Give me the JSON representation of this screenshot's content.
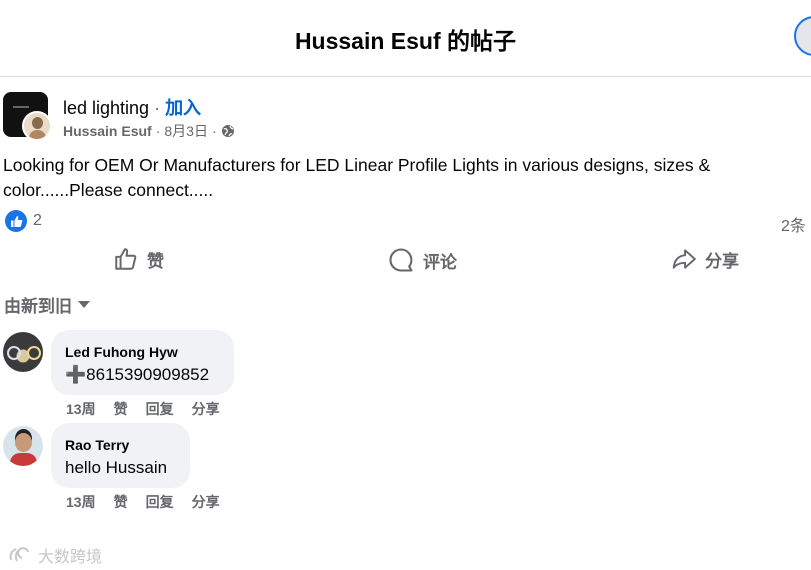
{
  "header": {
    "title": "Hussain Esuf 的帖子"
  },
  "post": {
    "group_name": "led lighting",
    "separator": " · ",
    "join_label": "加入",
    "author": "Hussain Esuf",
    "date": "8月3日",
    "meta_separator": "·",
    "privacy_icon": "globe-icon",
    "text": "Looking for OEM Or Manufacturers for LED Linear Profile Lights in various designs, sizes & color......Please connect.....",
    "reaction_icon": "like-icon",
    "reaction_count": "2",
    "comment_count": "2条"
  },
  "actions": {
    "like": "赞",
    "comment": "评论",
    "share": "分享"
  },
  "sort": {
    "label": "由新到旧"
  },
  "comments": [
    {
      "name": "Led Fuhong Hyw",
      "text": "➕8615390909852",
      "time": "13周",
      "like": "赞",
      "reply": "回复",
      "share": "分享"
    },
    {
      "name": "Rao Terry",
      "text": "hello Hussain",
      "time": "13周",
      "like": "赞",
      "reply": "回复",
      "share": "分享"
    }
  ],
  "watermark": {
    "text": "大数跨境"
  },
  "colors": {
    "accent": "#1b74e4",
    "link": "#0064d1",
    "secondary_text": "#65676b",
    "bubble": "#f0f2f5"
  }
}
